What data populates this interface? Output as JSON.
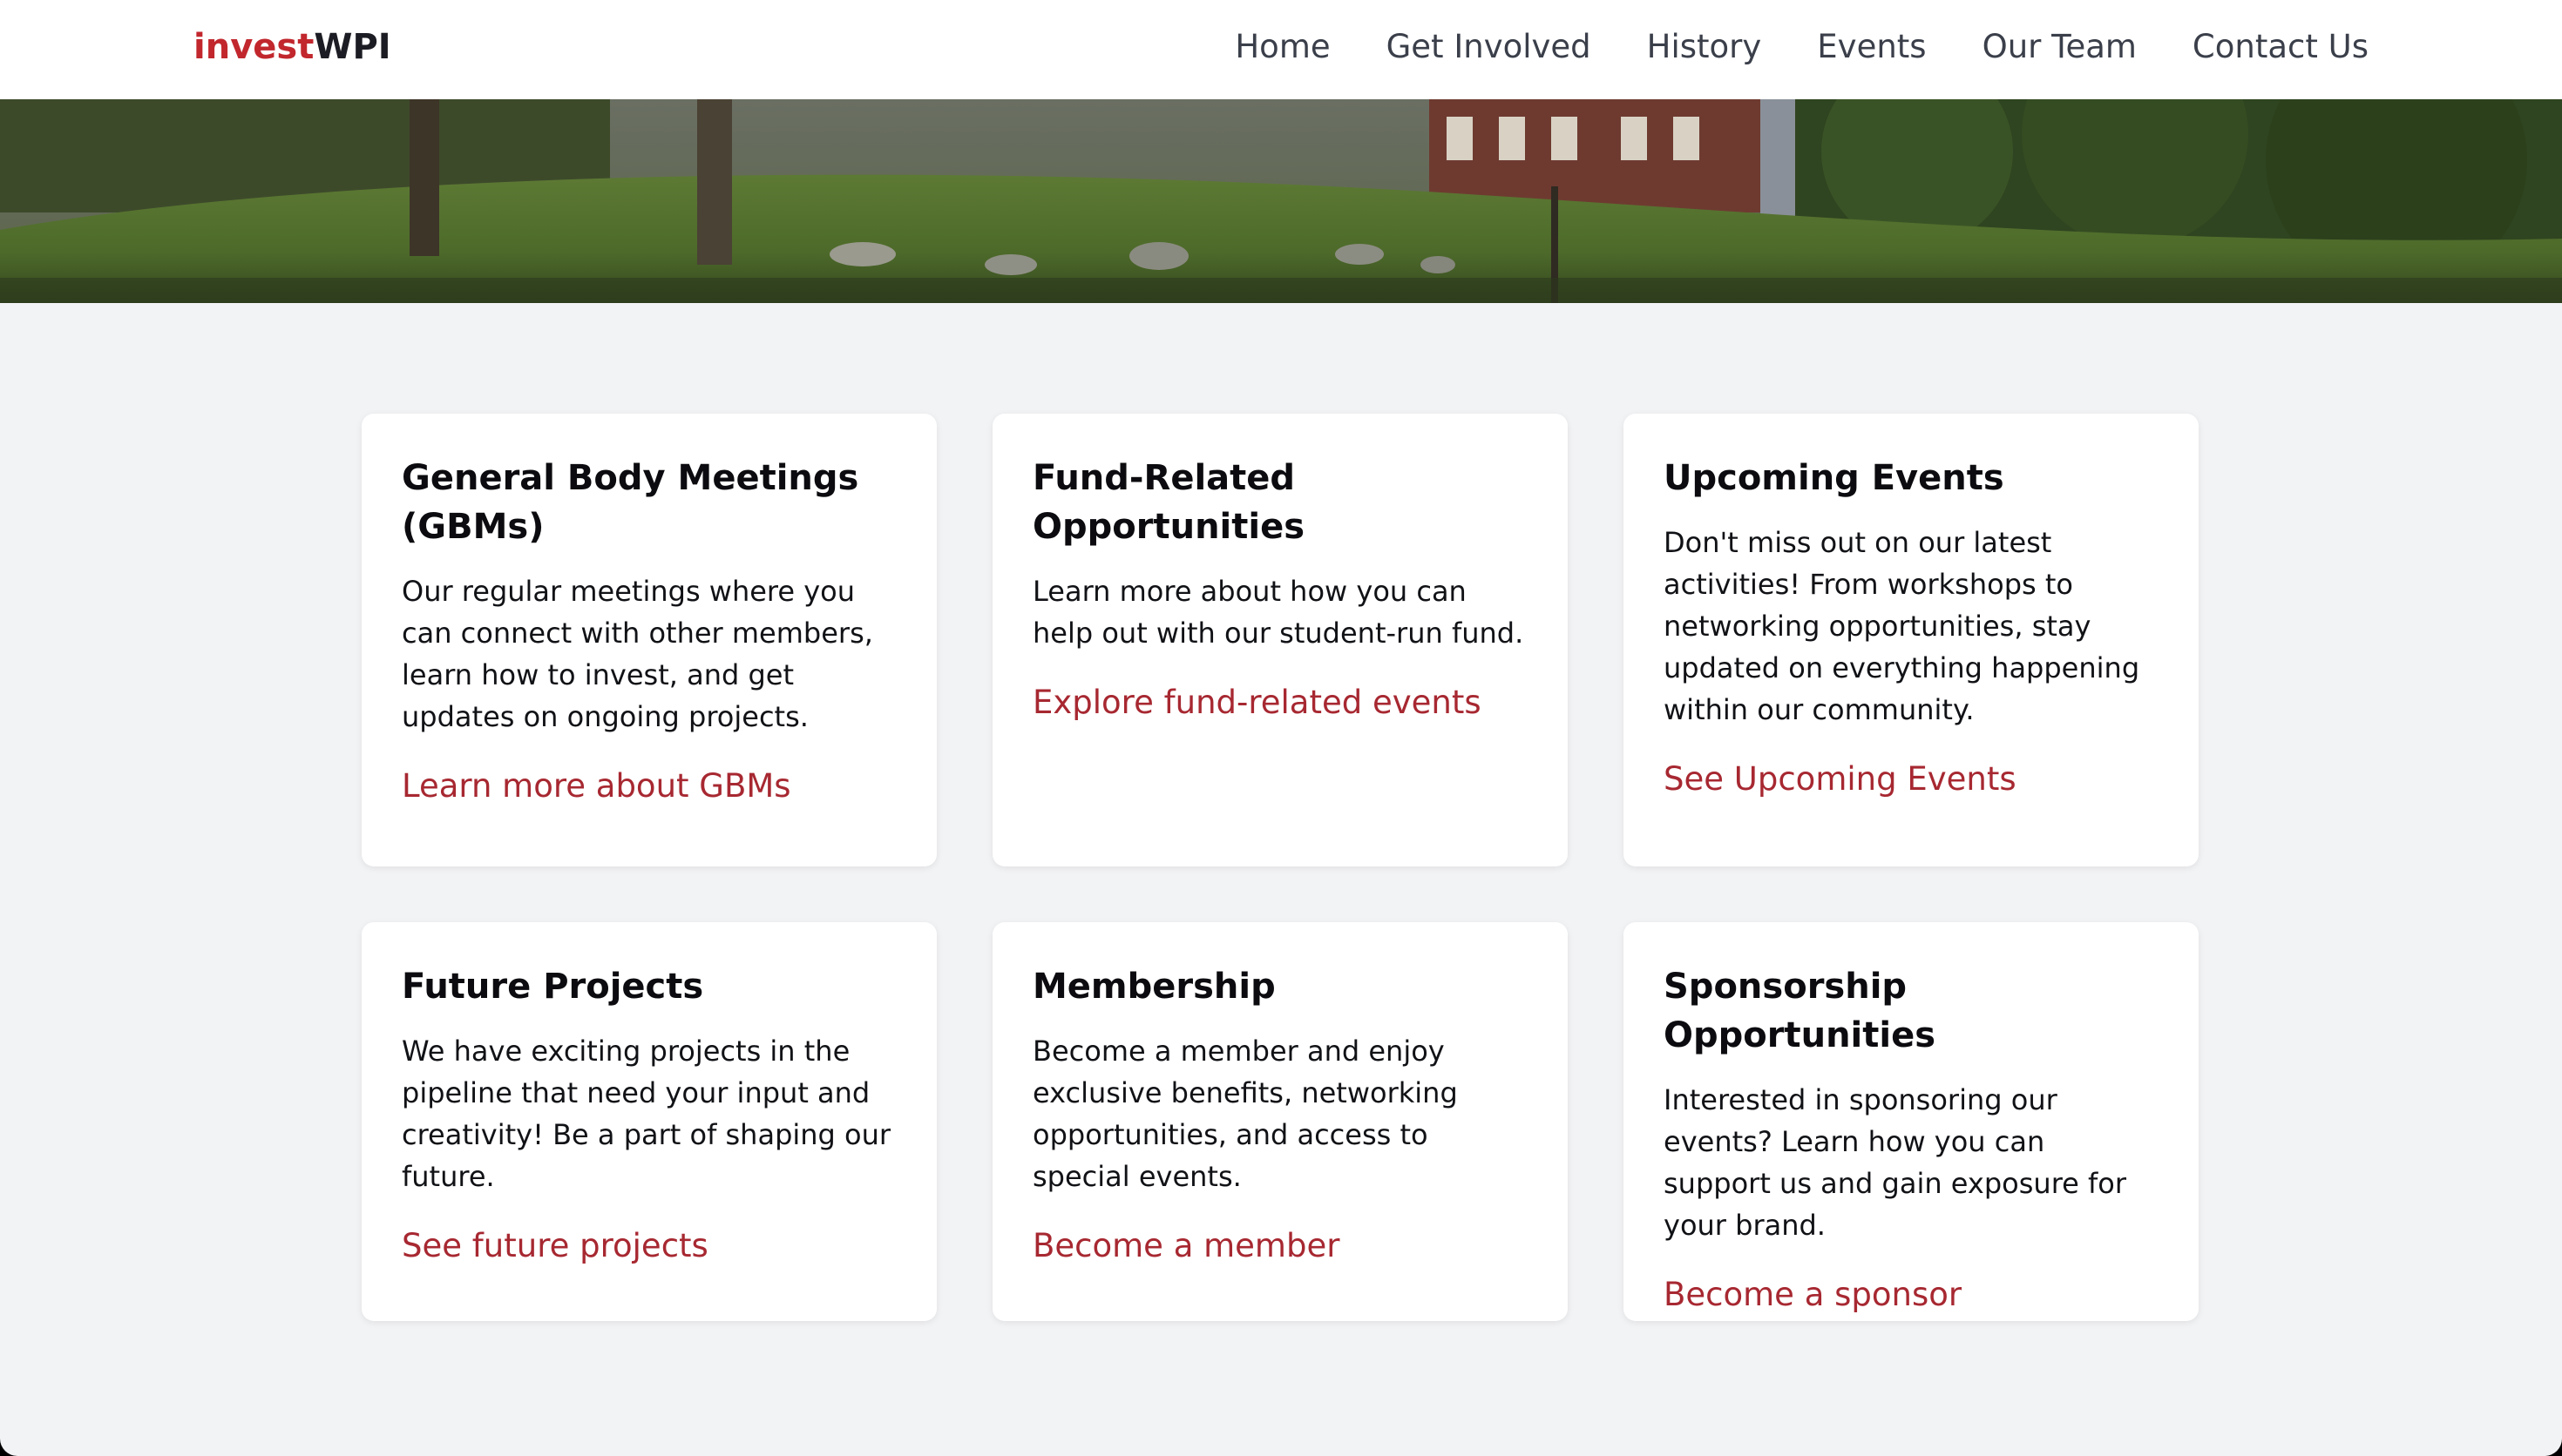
{
  "header": {
    "logo": {
      "part1": "invest",
      "part2": "WPI"
    },
    "nav": [
      "Home",
      "Get Involved",
      "History",
      "Events",
      "Our Team",
      "Contact Us"
    ]
  },
  "cards": [
    {
      "title": "General Body Meetings (GBMs)",
      "text": "Our regular meetings where you can connect with other members, learn how to invest, and get updates on ongoing projects.",
      "link": "Learn more about GBMs"
    },
    {
      "title": "Fund-Related Opportunities",
      "text": "Learn more about how you can help out with our student-run fund.",
      "link": "Explore fund-related events"
    },
    {
      "title": "Upcoming Events",
      "text": "Don't miss out on our latest activities! From workshops to networking opportunities, stay updated on everything happening within our community.",
      "link": "See Upcoming Events"
    },
    {
      "title": "Future Projects",
      "text": "We have exciting projects in the pipeline that need your input and creativity! Be a part of shaping our future.",
      "link": "See future projects"
    },
    {
      "title": "Membership",
      "text": "Become a member and enjoy exclusive benefits, networking opportunities, and access to special events.",
      "link": "Become a member"
    },
    {
      "title": "Sponsorship Opportunities",
      "text": "Interested in sponsoring our events? Learn how you can support us and gain exposure for your brand.",
      "link": "Become a sponsor"
    }
  ],
  "colors": {
    "brand_red": "#c1272d",
    "link_red": "#a72831",
    "page_bg": "#f2f3f5"
  }
}
